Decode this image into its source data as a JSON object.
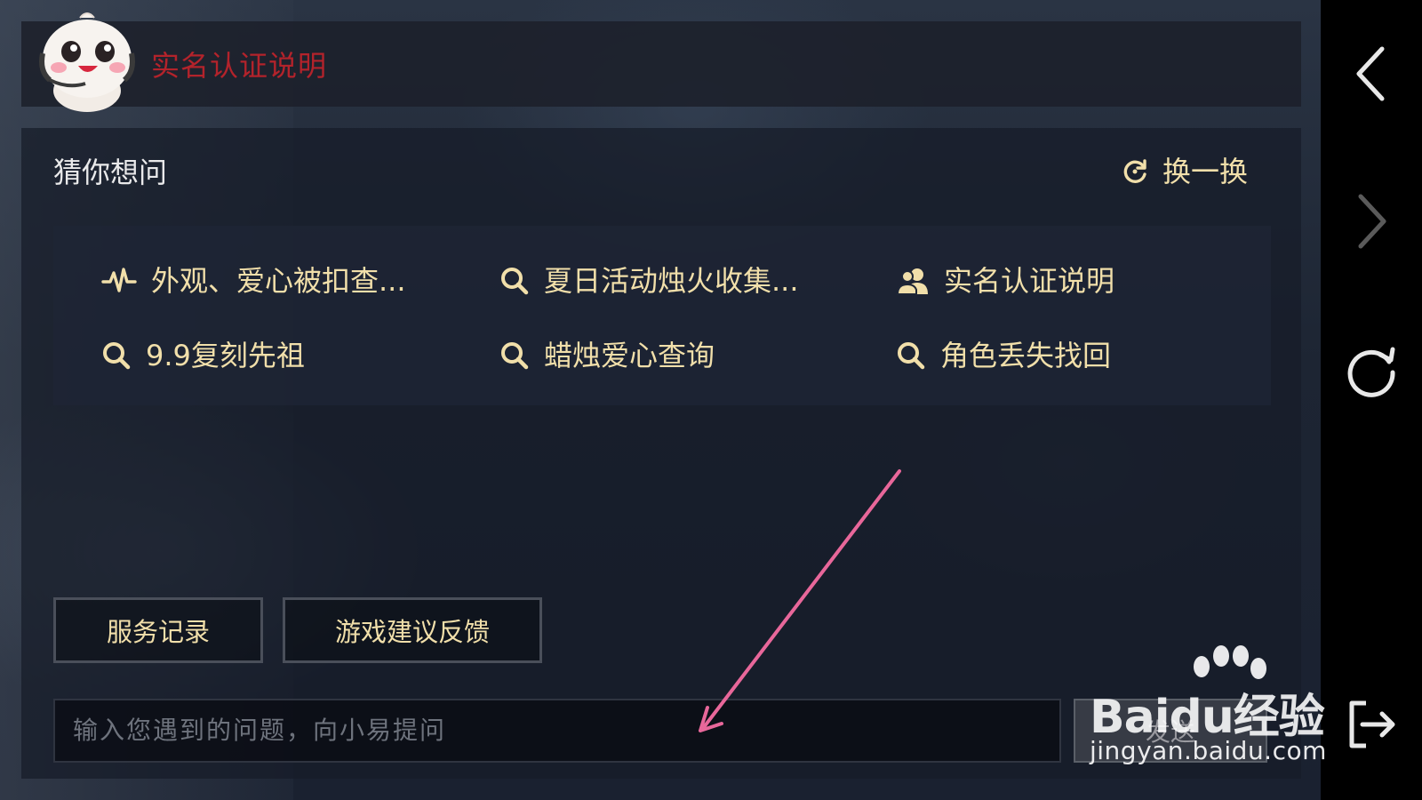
{
  "header": {
    "title": "实名认证说明",
    "title_color": "#b3232b",
    "mascot_icon": "mascot-avatar"
  },
  "guess": {
    "title": "猜你想问",
    "refresh_label": "换一换",
    "questions": [
      {
        "label": "外观、爱心被扣查...",
        "icon": "pulse-icon"
      },
      {
        "label": "夏日活动烛火收集...",
        "icon": "search-icon"
      },
      {
        "label": "实名认证说明",
        "icon": "users-icon"
      },
      {
        "label": "9.9复刻先祖",
        "icon": "search-icon"
      },
      {
        "label": "蜡烛爱心查询",
        "icon": "search-icon"
      },
      {
        "label": "角色丢失找回",
        "icon": "search-icon"
      }
    ]
  },
  "actions": {
    "service_record": "服务记录",
    "feedback": "游戏建议反馈"
  },
  "input": {
    "placeholder": "输入您遇到的问题，向小易提问",
    "send_label": "发送"
  },
  "rail": {
    "icons": [
      "back-icon",
      "forward-icon",
      "reload-icon",
      "exit-icon"
    ]
  },
  "watermark": {
    "brand": "Baidu经验",
    "url": "jingyan.baidu.com"
  },
  "colors": {
    "accent_text": "#f1dfaa",
    "annotation_arrow": "#e8679a"
  }
}
